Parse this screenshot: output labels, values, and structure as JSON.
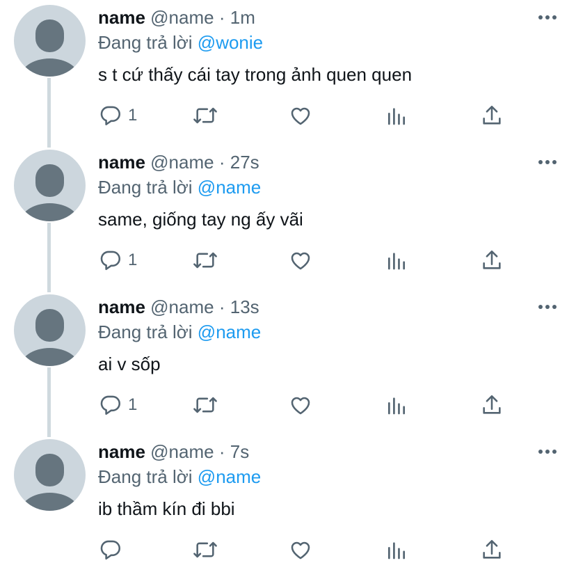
{
  "thread": {
    "tweets": [
      {
        "name": "name",
        "handle": "@name",
        "separator": "·",
        "time": "1m",
        "replying_prefix": "Đang trả lời",
        "replying_to": "@wonie",
        "text": "s t cứ thấy cái tay trong ảnh quen quen",
        "reply_count": "1"
      },
      {
        "name": "name",
        "handle": "@name",
        "separator": "·",
        "time": "27s",
        "replying_prefix": "Đang trả lời",
        "replying_to": "@name",
        "text": "same, giống tay ng ấy vãi",
        "reply_count": "1"
      },
      {
        "name": "name",
        "handle": "@name",
        "separator": "·",
        "time": "13s",
        "replying_prefix": "Đang trả lời",
        "replying_to": "@name",
        "text": "ai v sốp",
        "reply_count": "1"
      },
      {
        "name": "name",
        "handle": "@name",
        "separator": "·",
        "time": "7s",
        "replying_prefix": "Đang trả lời",
        "replying_to": "@name",
        "text": "ib thầm kín đi bbi",
        "reply_count": ""
      }
    ]
  },
  "colors": {
    "text_primary": "#0f1419",
    "text_secondary": "#536471",
    "mention_blue": "#1d9bf0",
    "thread_line": "#cfd9de",
    "avatar_bg": "#ccd6dd",
    "avatar_fg": "#66757f"
  },
  "icons": [
    "more-icon",
    "reply-icon",
    "retweet-icon",
    "like-icon",
    "analytics-icon",
    "share-icon"
  ]
}
